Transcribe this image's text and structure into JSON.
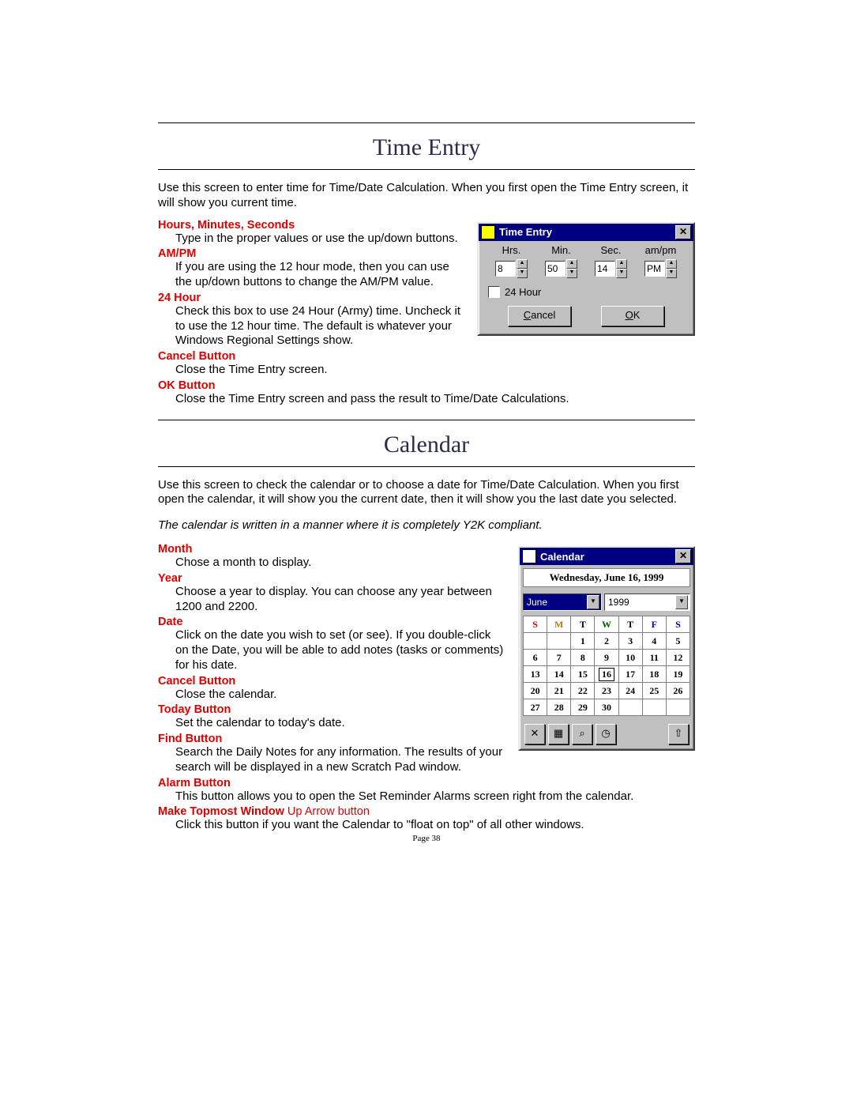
{
  "page_number": "Page 38",
  "section1": {
    "title": "Time Entry",
    "intro": "Use this screen to enter time for Time/Date Calculation.  When you first open the Time Entry screen, it will show you current time.",
    "items": {
      "hms": {
        "term": "Hours, Minutes, Seconds",
        "def": "Type in the proper values or use the up/down buttons."
      },
      "ampm": {
        "term": "AM/PM",
        "def": "If you are using the 12 hour mode, then you can use the up/down buttons to change the AM/PM value."
      },
      "h24": {
        "term": "24 Hour",
        "def": "Check this box to use 24 Hour (Army) time.  Uncheck it to use the 12 hour time.  The default is whatever your Windows Regional Settings show."
      },
      "cancel": {
        "term": "Cancel Button",
        "def": "Close the Time Entry screen."
      },
      "ok": {
        "term": "OK Button",
        "def": "Close the Time Entry screen and pass the result to Time/Date Calculations."
      }
    }
  },
  "te_win": {
    "title": "Time Entry",
    "labels": {
      "hrs": "Hrs.",
      "min": "Min.",
      "sec": "Sec.",
      "ampm": "am/pm"
    },
    "values": {
      "hrs": "8",
      "min": "50",
      "sec": "14",
      "ampm": "PM"
    },
    "check_label": "24 Hour",
    "cancel": "Cancel",
    "ok": "OK"
  },
  "section2": {
    "title": "Calendar",
    "intro": "Use this screen to check the calendar or to choose a date for Time/Date Calculation.  When you first open the calendar, it will show you the current date, then it will show you the last date you selected.",
    "note": "The calendar is written in a manner where it is completely Y2K compliant.",
    "items": {
      "month": {
        "term": "Month",
        "def": "Chose a month to display."
      },
      "year": {
        "term": "Year",
        "def": "Choose a year to display.  You can choose any year between 1200 and 2200."
      },
      "date": {
        "term": "Date",
        "def": "Click on the date you wish to set (or see).  If you double-click on the Date, you will be able to add notes (tasks or comments) for his date."
      },
      "cancel": {
        "term": "Cancel Button",
        "def": "Close the calendar."
      },
      "today": {
        "term": "Today Button",
        "def": "Set the calendar to today's date."
      },
      "find": {
        "term": "Find Button",
        "def": "Search the Daily Notes for any information.  The results of your search will be displayed in a new Scratch Pad window."
      },
      "alarm": {
        "term": "Alarm Button",
        "def": "This button allows you to open the Set Reminder Alarms screen right from the calendar."
      },
      "topmost": {
        "term": "Make Topmost Window",
        "suffix": " Up Arrow button",
        "def": "Click this button if you want the Calendar to \"float on top\" of all other windows."
      }
    }
  },
  "cal_win": {
    "title": "Calendar",
    "date_label": "Wednesday, June 16, 1999",
    "month": "June",
    "year": "1999",
    "dow": [
      "S",
      "M",
      "T",
      "W",
      "T",
      "F",
      "S"
    ],
    "weeks": [
      [
        "",
        "",
        "1",
        "2",
        "3",
        "4",
        "5"
      ],
      [
        "6",
        "7",
        "8",
        "9",
        "10",
        "11",
        "12"
      ],
      [
        "13",
        "14",
        "15",
        "16",
        "17",
        "18",
        "19"
      ],
      [
        "20",
        "21",
        "22",
        "23",
        "24",
        "25",
        "26"
      ],
      [
        "27",
        "28",
        "29",
        "30",
        "",
        "",
        ""
      ]
    ],
    "today": "16",
    "icons": {
      "cancel": "✕",
      "today": "▦",
      "find": "⌕",
      "alarm": "◷",
      "top": "⇧"
    }
  }
}
